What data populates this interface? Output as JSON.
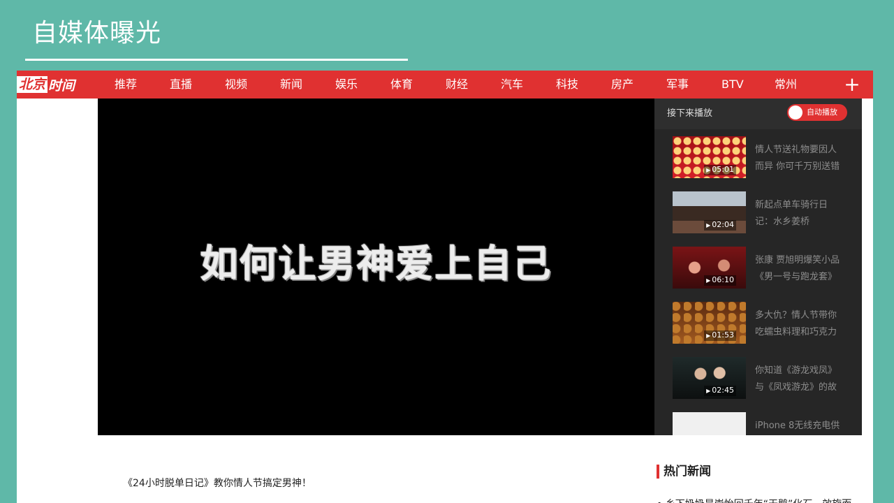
{
  "slide": {
    "title": "自媒体曝光"
  },
  "site": {
    "logo_part1": "北京",
    "logo_part2": "时间",
    "nav": [
      "推荐",
      "直播",
      "视频",
      "新闻",
      "娱乐",
      "体育",
      "财经",
      "汽车",
      "科技",
      "房产",
      "军事",
      "BTV",
      "常州"
    ],
    "plus": "+"
  },
  "player": {
    "title_text": "如何让男神爱上自己"
  },
  "playlist": {
    "heading": "接下来播放",
    "autoplay_label": "自动播放",
    "items": [
      {
        "duration": "05:01",
        "title": "情人节送礼物要因人\n而异 你可千万别送错"
      },
      {
        "duration": "02:04",
        "title": "新起点单车骑行日\n记：水乡姜桥"
      },
      {
        "duration": "06:10",
        "title": "张康 贾旭明爆笑小品\n《男一号与跑龙套》"
      },
      {
        "duration": "01:53",
        "title": "多大仇？情人节带你\n吃蠕虫料理和巧克力"
      },
      {
        "duration": "02:45",
        "title": "你知道《游龙戏凤》\n与《凤戏游龙》的故"
      },
      {
        "duration": "",
        "title": "iPhone 8无线充电供"
      }
    ]
  },
  "caption": "《24小时脱单日记》教你情人节搞定男神！",
  "hot_news": {
    "heading": "热门新闻",
    "first": "• 乡下奶奶是崇怡回千年“天鹅”化石，效旋而"
  },
  "colors": {
    "accent": "#e03131",
    "slide_bg": "#5fb8a8"
  }
}
